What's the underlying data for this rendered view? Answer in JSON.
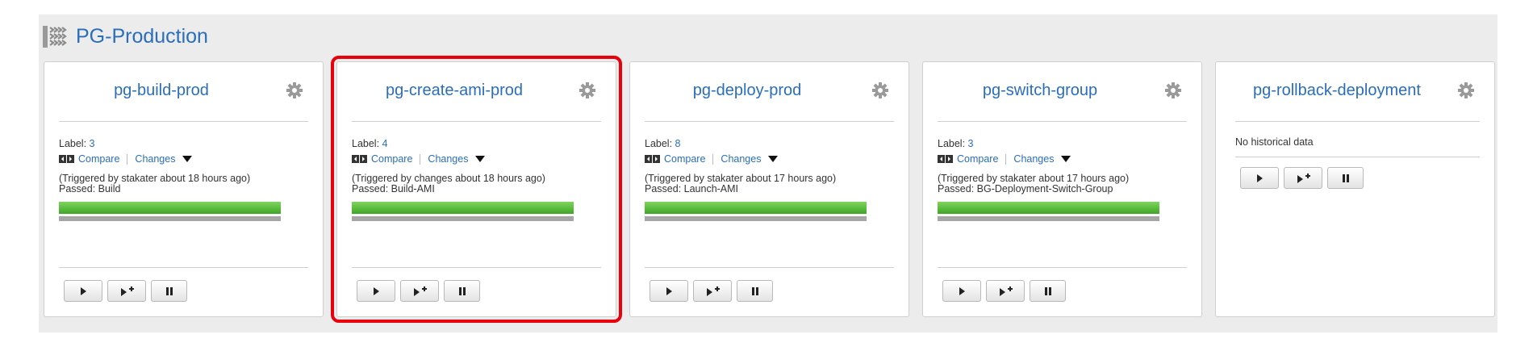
{
  "group": {
    "title": "PG-Production",
    "icon": "pipeline-group-icon"
  },
  "cards": [
    {
      "name": "pg-build-prod",
      "label_prefix": "Label:",
      "label": "3",
      "compare": "Compare",
      "changes": "Changes",
      "trigger": "(Triggered by stakater about 18 hours ago)",
      "passed": "Passed: Build",
      "status_color": "#4caf32"
    },
    {
      "name": "pg-create-ami-prod",
      "label_prefix": "Label:",
      "label": "4",
      "compare": "Compare",
      "changes": "Changes",
      "trigger": "(Triggered by changes about 18 hours ago)",
      "passed": "Passed: Build-AMI",
      "status_color": "#4caf32",
      "selected": true
    },
    {
      "name": "pg-deploy-prod",
      "label_prefix": "Label:",
      "label": "8",
      "compare": "Compare",
      "changes": "Changes",
      "trigger": "(Triggered by stakater about 17 hours ago)",
      "passed": "Passed: Launch-AMI",
      "status_color": "#4caf32"
    },
    {
      "name": "pg-switch-group",
      "label_prefix": "Label:",
      "label": "3",
      "compare": "Compare",
      "changes": "Changes",
      "trigger": "(Triggered by stakater about 17 hours ago)",
      "passed": "Passed: BG-Deployment-Switch-Group",
      "status_color": "#4caf32"
    },
    {
      "name": "pg-rollback-deployment",
      "no_history": "No historical data"
    }
  ],
  "colors": {
    "accent": "#2a6ebb",
    "group_title": "#5b2c6f",
    "selection": "#e8000b",
    "passed_bar": "#4caf32"
  }
}
